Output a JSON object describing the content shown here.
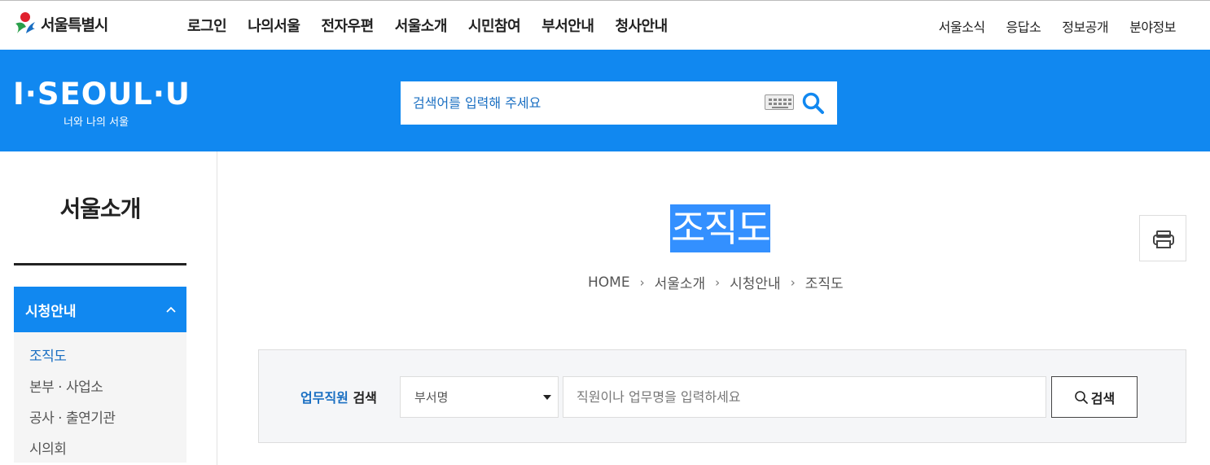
{
  "header": {
    "logo_text": "서울특별시",
    "gnb": [
      "로그인",
      "나의서울",
      "전자우편",
      "서울소개",
      "시민참여",
      "부서안내",
      "청사안내"
    ],
    "util": [
      "서울소식",
      "응답소",
      "정보공개",
      "분야정보"
    ]
  },
  "banner": {
    "brand_main": "I·SEOUL·U",
    "brand_sub": "너와 나의 서울",
    "search_placeholder": "검색어를 입력해 주세요",
    "bg_color": "#1188f0"
  },
  "lnb": {
    "title": "서울소개",
    "active_group": "시청안내",
    "items": [
      "조직도",
      "본부 · 사업소",
      "공사 · 출연기관",
      "시의회"
    ]
  },
  "content": {
    "page_title": "조직도",
    "breadcrumb": [
      "HOME",
      "서울소개",
      "시청안내",
      "조직도"
    ]
  },
  "staff_search": {
    "label_highlight": "업무직원",
    "label_rest": " 검색",
    "select_value": "부서명",
    "input_placeholder": "직원이나 업무명을 입력하세요",
    "button_label": "검색"
  }
}
